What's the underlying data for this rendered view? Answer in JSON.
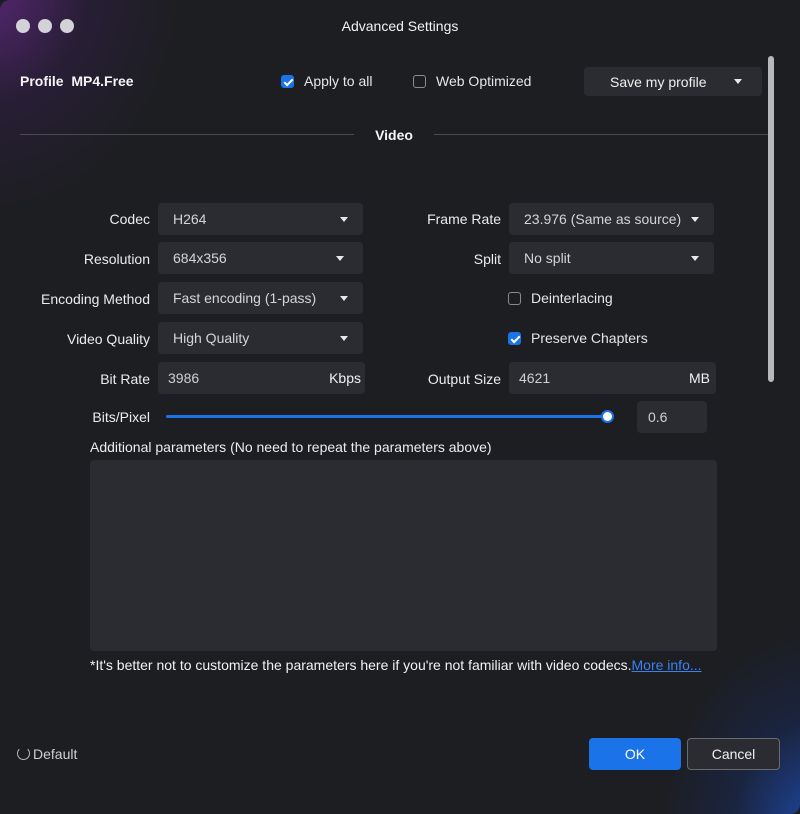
{
  "window": {
    "title": "Advanced Settings"
  },
  "header": {
    "profile_label": "Profile  MP4.Free",
    "apply_to_all": {
      "label": "Apply to all",
      "checked": true
    },
    "web_optimized": {
      "label": "Web Optimized",
      "checked": false
    },
    "save_profile_label": "Save my profile"
  },
  "section": {
    "title": "Video"
  },
  "fields": {
    "codec": {
      "label": "Codec",
      "value": "H264"
    },
    "resolution": {
      "label": "Resolution",
      "value": "684x356"
    },
    "encoding_method": {
      "label": "Encoding Method",
      "value": "Fast encoding (1-pass)"
    },
    "video_quality": {
      "label": "Video Quality",
      "value": "High Quality"
    },
    "bit_rate": {
      "label": "Bit Rate",
      "value": "3986",
      "unit": "Kbps"
    },
    "frame_rate": {
      "label": "Frame Rate",
      "value": "23.976 (Same as source)"
    },
    "split": {
      "label": "Split",
      "value": "No split"
    },
    "deinterlacing": {
      "label": "Deinterlacing",
      "checked": false
    },
    "preserve_chapters": {
      "label": "Preserve Chapters",
      "checked": true
    },
    "output_size": {
      "label": "Output Size",
      "value": "4621",
      "unit": "MB"
    },
    "bits_per_pixel": {
      "label": "Bits/Pixel",
      "value": "0.6",
      "slider_fraction": 1.0
    }
  },
  "additional": {
    "label": "Additional parameters (No need to repeat the parameters above)",
    "value": "",
    "note": "*It's better not to customize the parameters here if you're not familiar with video codecs.",
    "more_info_label": "More info..."
  },
  "footer": {
    "default_label": "Default",
    "ok_label": "OK",
    "cancel_label": "Cancel"
  },
  "colors": {
    "accent": "#1a73e8",
    "background": "#1d1e22",
    "control": "#2b2c31",
    "link": "#3a82f0"
  }
}
